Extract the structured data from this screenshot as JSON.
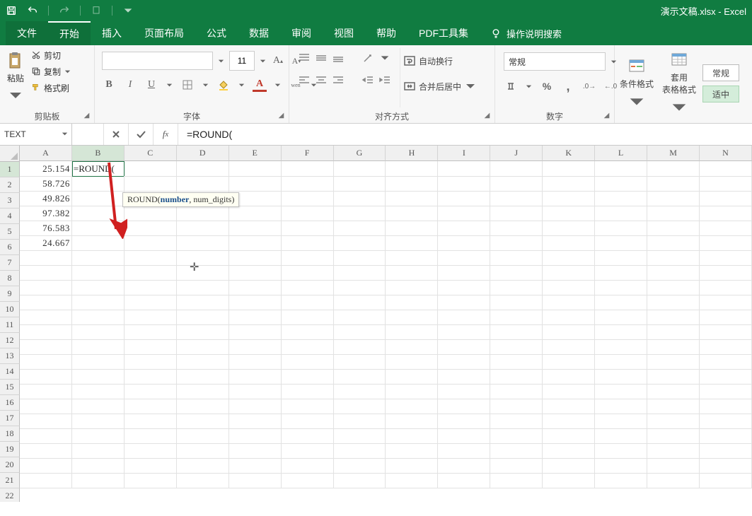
{
  "window": {
    "title": "演示文稿.xlsx - Excel",
    "app": "Excel"
  },
  "tabs": {
    "file": "文件",
    "home": "开始",
    "insert": "插入",
    "layout": "页面布局",
    "formulas": "公式",
    "data": "数据",
    "review": "审阅",
    "view": "视图",
    "help": "帮助",
    "pdf": "PDF工具集",
    "tell_me": "操作说明搜索"
  },
  "ribbon": {
    "clipboard": {
      "paste": "粘贴",
      "cut": "剪切",
      "copy": "复制",
      "format_painter": "格式刷",
      "group_label": "剪贴板"
    },
    "font": {
      "size": "11",
      "group_label": "字体"
    },
    "alignment": {
      "wrap": "自动换行",
      "merge": "合并后居中",
      "group_label": "对齐方式"
    },
    "number": {
      "format": "常规",
      "group_label": "数字"
    },
    "styles": {
      "cond": "条件格式",
      "tbl": "套用\n表格格式",
      "normal": "常规",
      "good": "适中"
    }
  },
  "formula_bar": {
    "name_box": "TEXT",
    "formula": "=ROUND("
  },
  "tooltip": {
    "fn": "ROUND(",
    "arg1": "number",
    "rest": ", num_digits)"
  },
  "columns": [
    "A",
    "B",
    "C",
    "D",
    "E",
    "F",
    "G",
    "H",
    "I",
    "J",
    "K",
    "L",
    "M",
    "N"
  ],
  "selected_col": "B",
  "selected_row": 1,
  "active_cell_display": "=ROUND(",
  "data_col_a": [
    "25.154",
    "58.726",
    "49.826",
    "97.382",
    "76.583",
    "24.667"
  ],
  "num_rows": 22
}
